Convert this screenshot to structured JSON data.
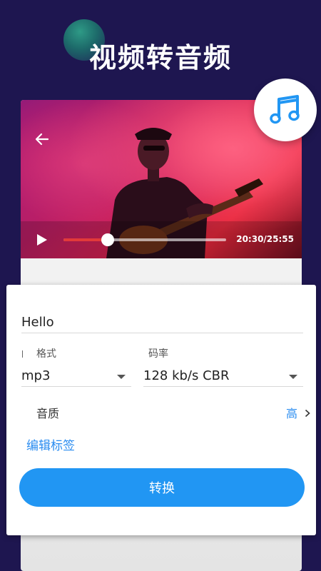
{
  "header": {
    "title": "视频转音频",
    "badge_icon": "music-note-icon"
  },
  "player": {
    "time_label": "20:30/25:55",
    "progress": 0.27,
    "back_icon": "back-arrow-icon",
    "play_icon": "play-icon"
  },
  "form": {
    "file_name": "Hello",
    "format_label": "格式",
    "format_value": "mp3",
    "bitrate_label": "码率",
    "bitrate_value": "128 kb/s CBR",
    "quality_label": "音质",
    "quality_value": "高",
    "edit_tags_label": "编辑标签",
    "convert_label": "转换"
  },
  "colors": {
    "background": "#1e1650",
    "accent": "#2196f3",
    "link": "#2a8cf0"
  }
}
